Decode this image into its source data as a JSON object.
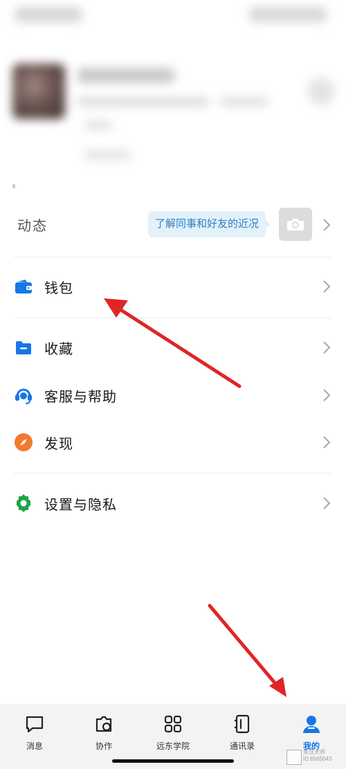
{
  "feed": {
    "label": "动态",
    "hint": "了解同事和好友的近况",
    "icon": "camera-icon"
  },
  "menu": [
    {
      "label": "钱包",
      "icon": "wallet-icon",
      "color": "#1677e6"
    },
    {
      "label": "收藏",
      "icon": "folder-icon",
      "color": "#1677e6"
    },
    {
      "label": "客服与帮助",
      "icon": "headset-icon",
      "color": "#1677e6"
    },
    {
      "label": "发现",
      "icon": "compass-icon",
      "color": "#f07a2e"
    },
    {
      "label": "设置与隐私",
      "icon": "gear-icon",
      "color": "#1fa34a"
    }
  ],
  "bottom_nav": [
    {
      "label": "消息",
      "icon": "message-icon",
      "active": false
    },
    {
      "label": "协作",
      "icon": "collaboration-icon",
      "active": false
    },
    {
      "label": "远东学院",
      "icon": "grid-apps-icon",
      "active": false
    },
    {
      "label": "通讯录",
      "icon": "contacts-book-icon",
      "active": false
    },
    {
      "label": "我的",
      "icon": "person-icon",
      "active": true
    }
  ],
  "watermark": {
    "line1": "头条",
    "line2": "关注大师",
    "line3": "ID:6565043"
  },
  "colors": {
    "accent": "#1677e6",
    "arrow": "#e02525"
  }
}
